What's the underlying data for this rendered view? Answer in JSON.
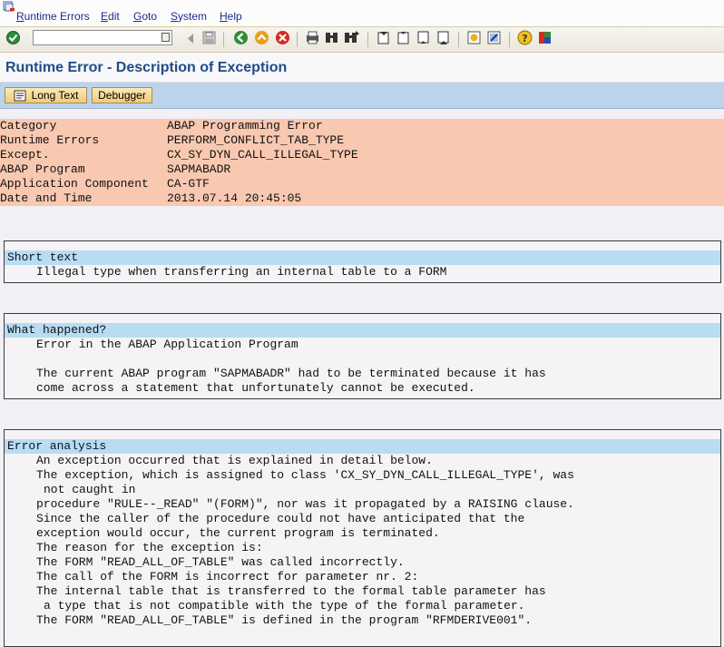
{
  "menu": [
    "Runtime Errors",
    "Edit",
    "Goto",
    "System",
    "Help"
  ],
  "menu_mnemonics": [
    "R",
    "E",
    "G",
    "S",
    "H"
  ],
  "command_field": {
    "value": ""
  },
  "title": "Runtime Error - Description of Exception",
  "app_toolbar": {
    "long_text": "Long Text",
    "debugger": "Debugger"
  },
  "header": [
    {
      "label": "Category",
      "value": "ABAP Programming Error"
    },
    {
      "label": "Runtime Errors",
      "value": "PERFORM_CONFLICT_TAB_TYPE"
    },
    {
      "label": "Except.",
      "value": "CX_SY_DYN_CALL_ILLEGAL_TYPE"
    },
    {
      "label": "ABAP Program",
      "value": "SAPMABADR"
    },
    {
      "label": "Application Component",
      "value": "CA-GTF"
    },
    {
      "label": "Date and Time",
      "value": "2013.07.14 20:45:05"
    }
  ],
  "short_text": {
    "heading": "Short text",
    "lines": [
      "Illegal type when transferring an internal table to a FORM"
    ]
  },
  "what_happened": {
    "heading": "What happened?",
    "lines": [
      "Error in the ABAP Application Program",
      "",
      "The current ABAP program \"SAPMABADR\" had to be terminated because it has",
      "come across a statement that unfortunately cannot be executed."
    ]
  },
  "error_analysis": {
    "heading": "Error analysis",
    "lines": [
      "An exception occurred that is explained in detail below.",
      "The exception, which is assigned to class 'CX_SY_DYN_CALL_ILLEGAL_TYPE', was",
      "not caught in",
      "procedure \"RULE--_READ\" \"(FORM)\", nor was it propagated by a RAISING clause.",
      "Since the caller of the procedure could not have anticipated that the",
      "exception would occur, the current program is terminated.",
      "The reason for the exception is:",
      "The FORM \"READ_ALL_OF_TABLE\" was called incorrectly.",
      "The call of the FORM is incorrect for parameter nr. 2:",
      "The internal table that is transferred to the formal table parameter has",
      "a type that is not compatible with the type of the formal parameter.",
      "The FORM \"READ_ALL_OF_TABLE\" is defined in the program \"RFMDERIVE001\"."
    ]
  },
  "colors": {
    "title": "#1e4c86",
    "header_bg": "#f8c8b0",
    "section_head_bg": "#b7dcf4",
    "app_toolbar_bg": "#bcd3ec"
  },
  "icons": [
    "sap-system-icon",
    "enter-check-icon",
    "back-icon",
    "save-icon",
    "back-green-icon",
    "exit-icon",
    "cancel-icon",
    "print-icon",
    "find-icon",
    "find-next-icon",
    "first-page-icon",
    "prev-page-icon",
    "next-page-icon",
    "last-page-icon",
    "create-session-icon",
    "shortcut-icon",
    "help-icon",
    "layout-icon",
    "long-text-icon"
  ]
}
